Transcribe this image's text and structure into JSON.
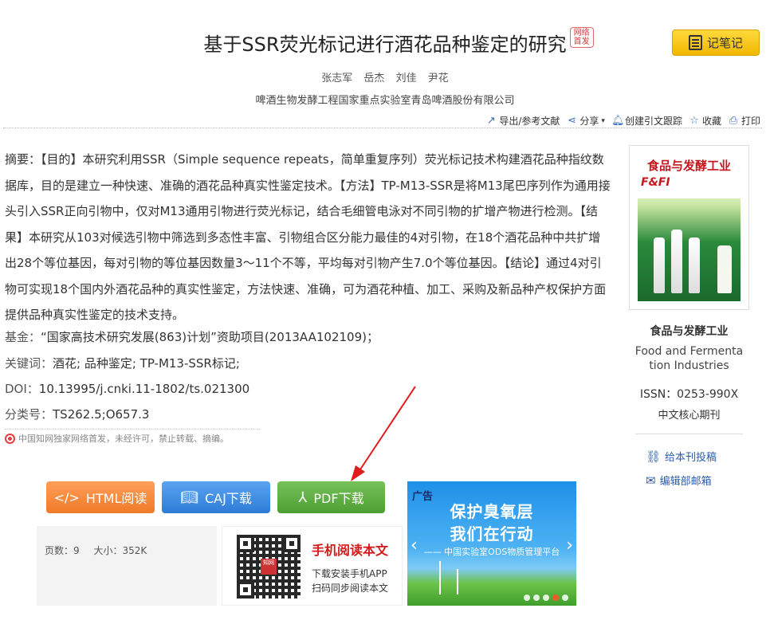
{
  "title": "基于SSR荧光标记进行酒花品种鉴定的研究",
  "net_badge": "网络首发",
  "note_button": "记笔记",
  "authors": [
    "张志军",
    "岳杰",
    "刘佳",
    "尹花"
  ],
  "affiliation": "啤酒生物发酵工程国家重点实验室青岛啤酒股份有限公司",
  "toolbar": {
    "export": "导出/参考文献",
    "share": "分享",
    "track": "创建引文跟踪",
    "favorite": "收藏",
    "print": "打印"
  },
  "abstract": "摘要：【目的】本研究利用SSR（Simple sequence repeats，简单重复序列）荧光标记技术构建酒花品种指纹数据库，目的是建立一种快速、准确的酒花品种真实性鉴定技术。【方法】TP-M13-SSR是将M13尾巴序列作为通用接头引入SSR正向引物中，仅对M13通用引物进行荧光标记，结合毛细管电泳对不同引物的扩增产物进行检测。【结果】本研究从103对候选引物中筛选到多态性丰富、引物组合区分能力最佳的4对引物，在18个酒花品种中共扩增出28个等位基因，每对引物的等位基因数量3～11个不等，平均每对引物产生7.0个等位基因。【结论】通过4对引物可实现18个国内外酒花品种的真实性鉴定，方法快速、准确，可为酒花种植、加工、采购及新品种产权保护方面提供品种真实性鉴定的技术支持。",
  "fund": {
    "label": "基金：",
    "value": "“国家高技术研究发展(863)计划”资助项目(2013AA102109)；"
  },
  "keywords": {
    "label": "关键词：",
    "value": "酒花; 品种鉴定; TP-M13-SSR标记;"
  },
  "doi": {
    "label": "DOI：",
    "value": "10.13995/j.cnki.11-1802/ts.021300"
  },
  "classification": {
    "label": "分类号：",
    "value": "TS262.5;O657.3"
  },
  "notice": "中国知网独家网络首发，未经许可，禁止转载、摘编。",
  "journal": {
    "cover_title": "食品与发酵工业",
    "name_cn": "食品与发酵工业",
    "name_en_1": "Food and Fermenta",
    "name_en_2": "tion Industries",
    "issn": "ISSN：0253-990X",
    "core": "中文核心期刊",
    "submit_link": "给本刊投稿",
    "editor_link": "编辑部邮箱"
  },
  "buttons": {
    "html": "HTML阅读",
    "caj": "CAJ下载",
    "pdf": "PDF下载"
  },
  "file_info": {
    "pages": "页数：9",
    "size": "大小：352K"
  },
  "mobile": {
    "title": "手机阅读本文",
    "line1": "下载安装手机APP",
    "line2": "扫码同步阅读本文",
    "qr_logo": "知网"
  },
  "ad": {
    "tag": "广告",
    "line1": "保护臭氧层",
    "line2": "我们在行动",
    "line3": "—— 中国实验室ODS物质管理平台"
  },
  "colors": {
    "note_button": "#f1b800",
    "html_button": "#f07a2a",
    "caj_button": "#2d7bd6",
    "pdf_button": "#4d9f33",
    "arrow": "#e01b1b"
  }
}
